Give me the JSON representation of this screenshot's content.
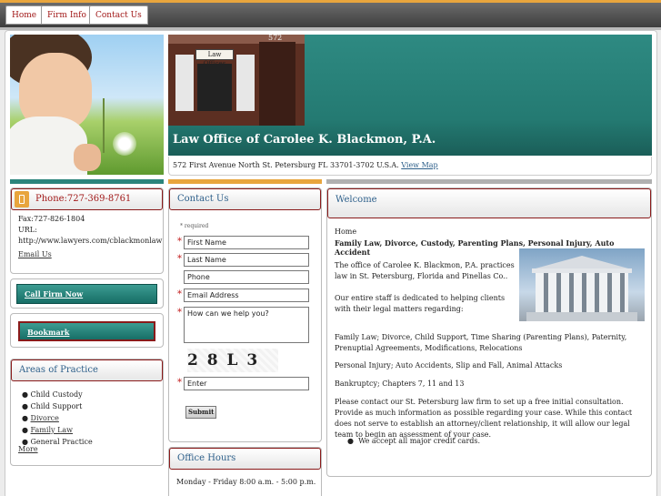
{
  "nav": {
    "home": "Home",
    "firm_info": "Firm Info",
    "contact_us": "Contact Us"
  },
  "header": {
    "title": "Law Office of Carolee K. Blackmon, P.A.",
    "sign_text": "Law Offices",
    "house_number": "572",
    "address": "572 First Avenue North St. Petersburg FL 33701-3702 U.S.A.",
    "view_map": "View Map"
  },
  "contact_card": {
    "phone": "Phone:727-369-8761",
    "fax": "Fax:727-826-1804",
    "url_label": "URL:",
    "url": "http://www.lawyers.com/cblackmonlaw",
    "email": "Email Us"
  },
  "call_firm": "Call Firm Now",
  "bookmark": "Bookmark",
  "areas": {
    "title": "Areas of Practice",
    "items": [
      {
        "label": "Child Custody",
        "link": false
      },
      {
        "label": "Child Support",
        "link": false
      },
      {
        "label": "Divorce",
        "link": true
      },
      {
        "label": "Family Law",
        "link": true
      },
      {
        "label": "General Practice",
        "link": false
      }
    ],
    "more": "More"
  },
  "contact_form": {
    "title": "Contact Us",
    "required": "* required",
    "first_name": "First Name",
    "last_name": "Last Name",
    "phone": "Phone",
    "email": "Email Address",
    "message": "How can we help you?",
    "captcha": "2 8 L 3 A",
    "enter": "Enter",
    "submit": "Submit"
  },
  "office_hours": {
    "title": "Office Hours",
    "hours": "Monday - Friday 8:00 a.m. - 5:00 p.m."
  },
  "welcome": {
    "title": "Welcome",
    "breadcrumb": "Home",
    "headline": "Family Law, Divorce, Custody, Parenting Plans, Personal Injury, Auto Accident",
    "p1": "The office of Carolee K. Blackmon, P.A. practices law in St. Petersburg, Florida and Pinellas Co..",
    "p2": "Our entire staff is dedicated to helping clients with their legal matters regarding:",
    "p3": "Family Law; Divorce, Child Support, Time Sharing (Parenting Plans), Paternity, Prenuptial Agreements, Modifications, Relocations",
    "p4": "Personal Injury; Auto Accidents, Slip and Fall, Animal Attacks",
    "p5": "Bankruptcy; Chapters 7, 11 and 13",
    "p6": "Please contact our St. Petersburg law firm to set up a free initial consultation. Provide as much information as possible regarding your case. While this contact does not serve to establish an attorney/client relationship, it will allow our legal team to begin an assessment of your case.",
    "bullet": "We accept all major credit cards."
  },
  "colors": {
    "accent_red": "#8a1a1a",
    "teal": "#2b857c",
    "link_blue": "#2d5f8a",
    "orange": "#e8a53d"
  }
}
